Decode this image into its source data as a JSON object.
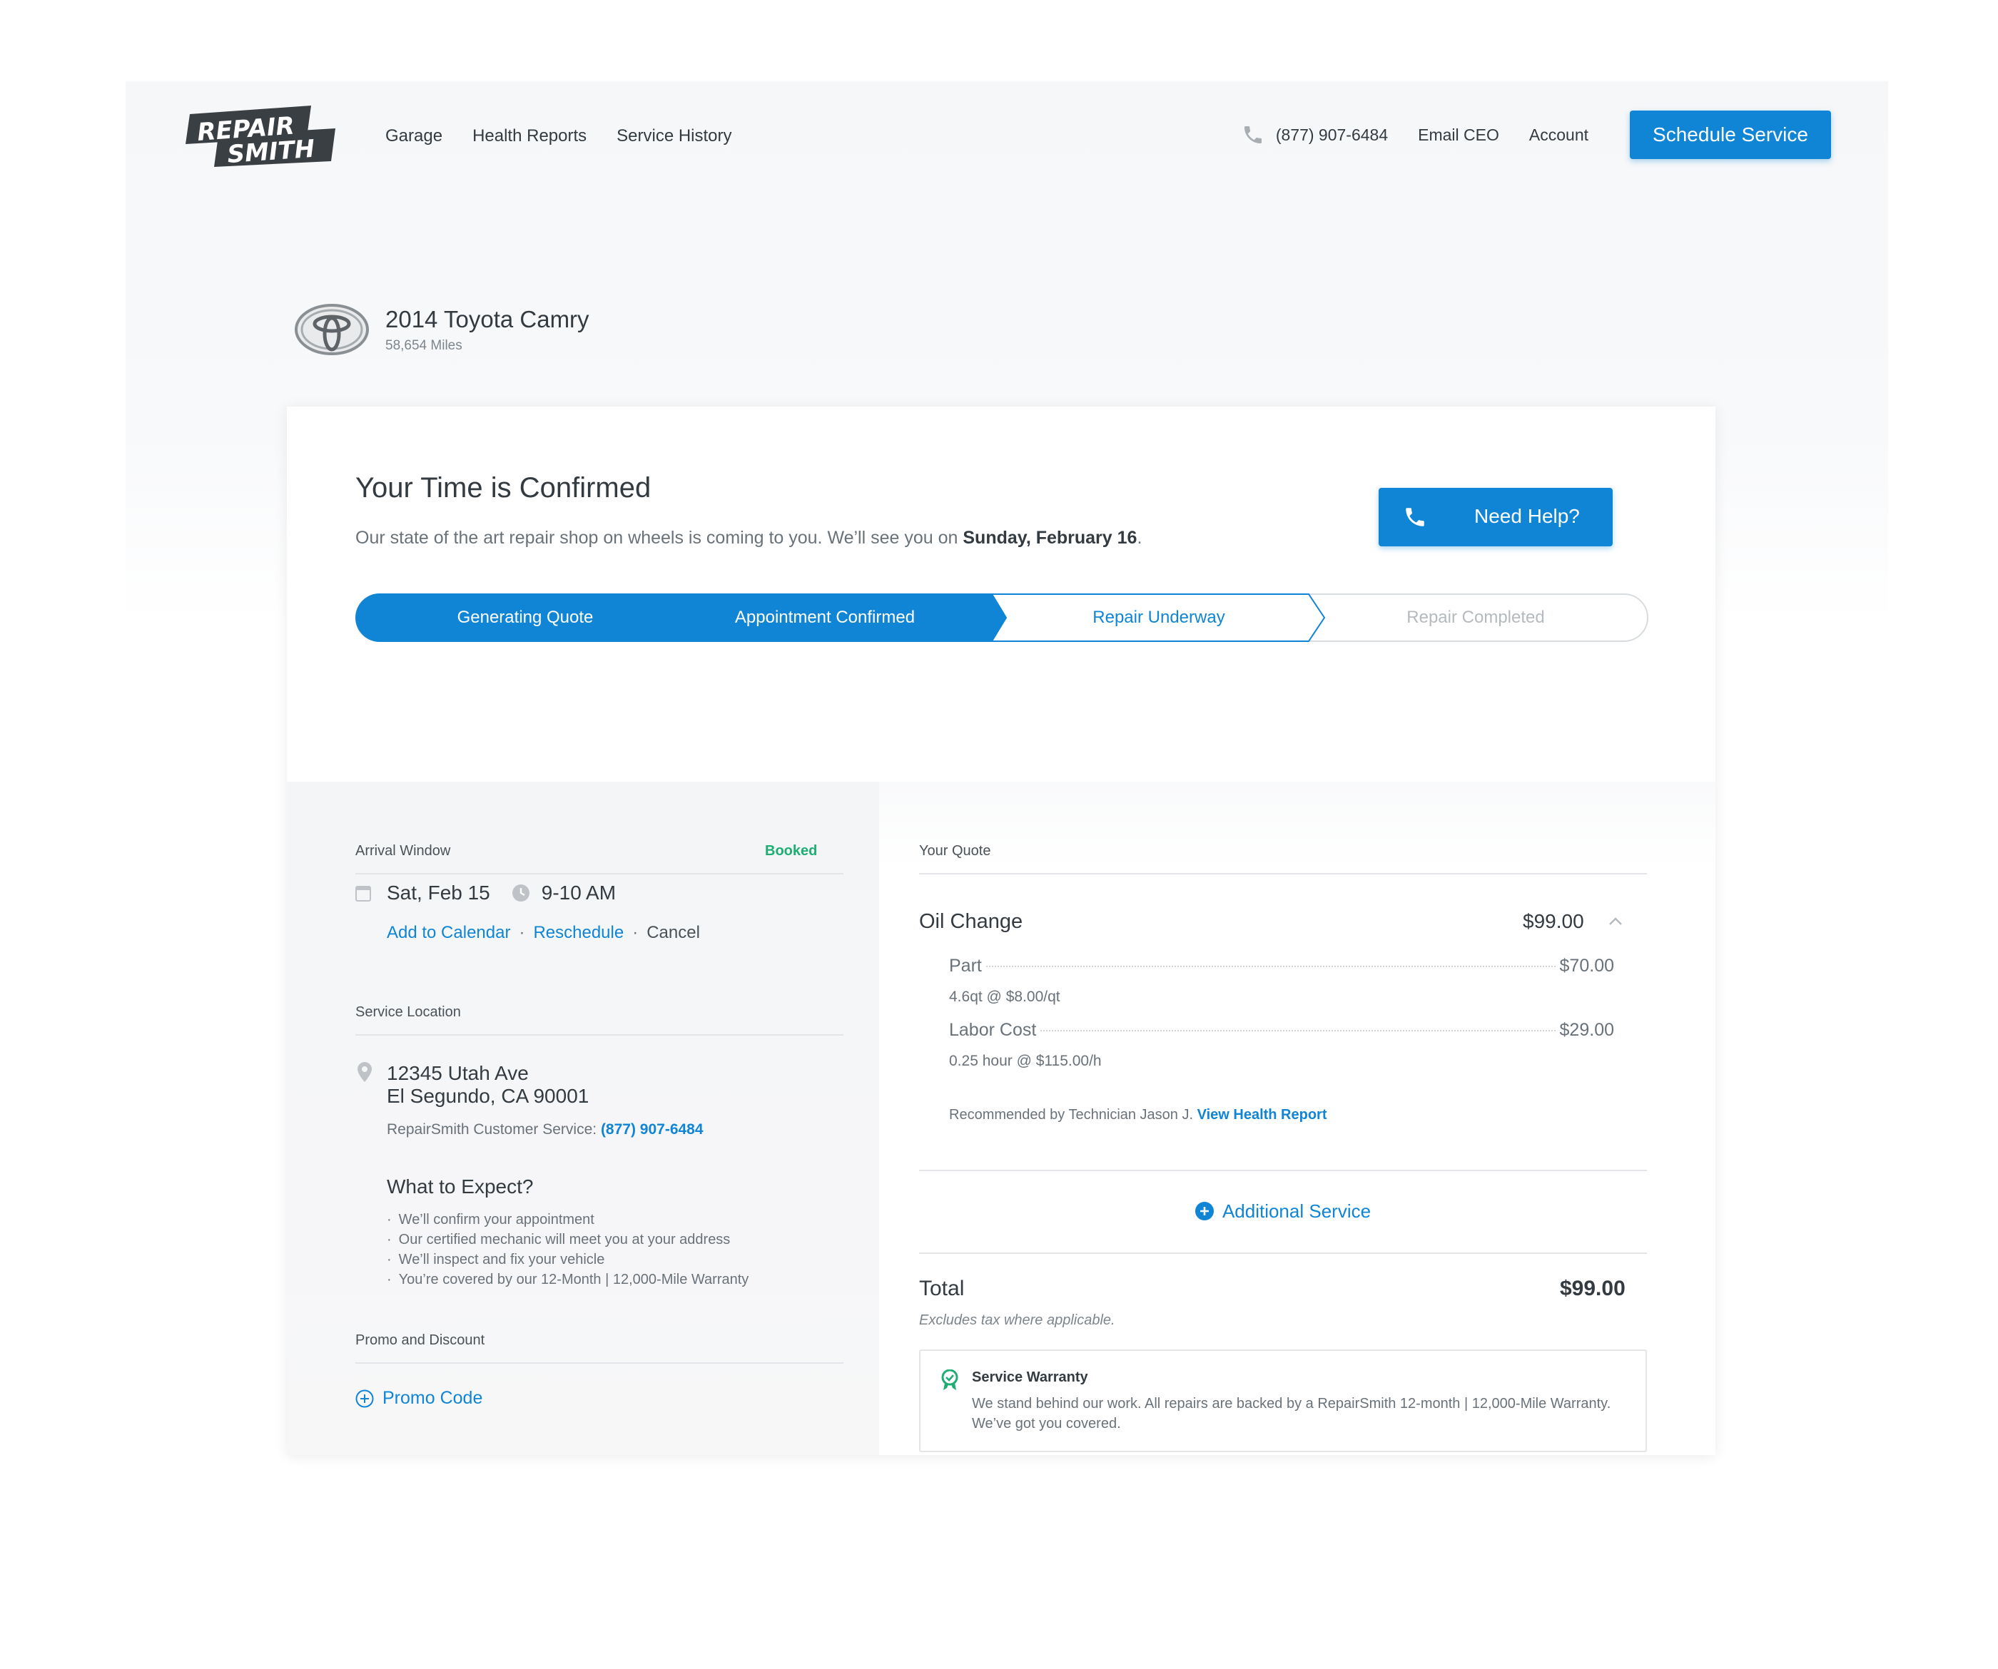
{
  "brand": {
    "logo_line1": "REPAIR",
    "logo_line2": "SMITH",
    "accent": "#1085d6",
    "success": "#1eae74"
  },
  "nav": {
    "items": [
      "Garage",
      "Health Reports",
      "Service History"
    ]
  },
  "header": {
    "phone_icon": "phone-icon",
    "phone": "(877) 907-6484",
    "email_ceo": "Email CEO",
    "account": "Account",
    "schedule_button": "Schedule Service"
  },
  "vehicle": {
    "logo_icon": "toyota-logo-icon",
    "name": "2014 Toyota Camry",
    "miles": "58,654 Miles"
  },
  "confirmation": {
    "title": "Your Time is Confirmed",
    "subtitle_prefix": "Our state of the art repair shop on wheels is coming to you. We’ll see you on ",
    "subtitle_date": "Sunday, February 16",
    "subtitle_suffix": ".",
    "help_button": "Need Help?"
  },
  "progress": {
    "steps": [
      {
        "label": "Generating Quote",
        "state": "complete"
      },
      {
        "label": "Appointment Confirmed",
        "state": "complete"
      },
      {
        "label": "Repair Underway",
        "state": "current"
      },
      {
        "label": "Repair Completed",
        "state": "upcoming"
      }
    ]
  },
  "arrival": {
    "label": "Arrival Window",
    "status": "Booked",
    "date": "Sat, Feb 15",
    "time": "9-10 AM",
    "add_to_calendar": "Add to Calendar",
    "reschedule": "Reschedule",
    "cancel": "Cancel",
    "separator": "·"
  },
  "location": {
    "label": "Service Location",
    "line1": "12345 Utah Ave",
    "line2": "El Segundo, CA 90001",
    "cs_label": "RepairSmith Customer Service: ",
    "cs_phone": "(877) 907-6484"
  },
  "expect": {
    "title": "What to Expect?",
    "items": [
      "We’ll confirm your appointment",
      "Our certified mechanic will meet you at your address",
      "We’ll inspect and fix your vehicle",
      "You’re covered by our 12-Month | 12,000-Mile Warranty"
    ]
  },
  "promo": {
    "label": "Promo and Discount",
    "link": "Promo Code"
  },
  "quote": {
    "label": "Your Quote",
    "service": "Oil Change",
    "service_price": "$99.00",
    "items": [
      {
        "label": "Part",
        "amount": "$70.00",
        "detail": "4.6qt @ $8.00/qt"
      },
      {
        "label": "Labor Cost",
        "amount": "$29.00",
        "detail": "0.25 hour @ $115.00/h"
      }
    ],
    "recommended_text": "Recommended by Technician Jason J. ",
    "recommended_link": "View Health Report",
    "additional_service": "Additional Service",
    "total_label": "Total",
    "total_amount": "$99.00",
    "total_note": "Excludes tax where applicable."
  },
  "warranty": {
    "title": "Service Warranty",
    "body": "We stand behind our work. All repairs are backed by a RepairSmith 12-month | 12,000-Mile Warranty. We’ve got you covered."
  }
}
